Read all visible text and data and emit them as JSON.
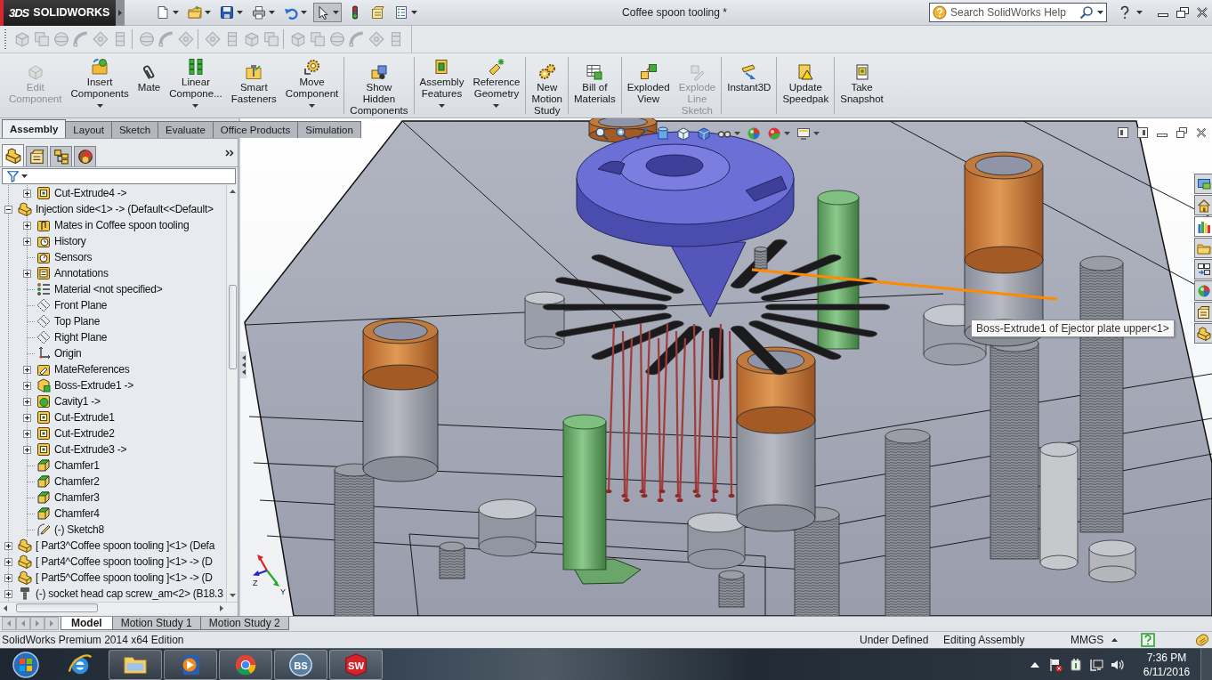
{
  "title_bar": {
    "logo_mark": "3DS",
    "logo_text": "SOLIDWORKS",
    "document_title": "Coffee spoon tooling *",
    "search": {
      "placeholder": "Search SolidWorks Help"
    }
  },
  "quick_access": [
    {
      "kind": "new-document",
      "dropdown": true,
      "selected": false
    },
    {
      "kind": "open",
      "dropdown": true,
      "selected": false
    },
    {
      "kind": "save",
      "dropdown": true,
      "selected": false
    },
    {
      "kind": "print",
      "dropdown": true,
      "selected": false
    },
    {
      "kind": "undo",
      "dropdown": true,
      "selected": false
    },
    {
      "kind": "select",
      "dropdown": true,
      "selected": true
    },
    {
      "kind": "rebuild",
      "dropdown": false,
      "selected": false
    },
    {
      "kind": "options",
      "dropdown": false,
      "selected": false
    },
    {
      "kind": "file-properties",
      "dropdown": true,
      "selected": false
    }
  ],
  "secondary_toolbar": {
    "disabled": true
  },
  "command_groups": [
    {
      "buttons": [
        {
          "kind": "edit-component",
          "label": "Edit\nComponent",
          "disabled": true,
          "dropdown": false
        },
        {
          "kind": "insert-components",
          "label": "Insert\nComponents",
          "disabled": false,
          "dropdown": true
        },
        {
          "kind": "mate",
          "label": "Mate",
          "disabled": false,
          "dropdown": false
        },
        {
          "kind": "linear-pattern",
          "label": "Linear\nCompone...",
          "disabled": false,
          "dropdown": true
        },
        {
          "kind": "smart-fasteners",
          "label": "Smart\nFasteners",
          "disabled": false,
          "dropdown": false
        },
        {
          "kind": "move-component",
          "label": "Move\nComponent",
          "disabled": false,
          "dropdown": true
        }
      ]
    },
    {
      "buttons": [
        {
          "kind": "show-hidden",
          "label": "Show\nHidden\nComponents",
          "disabled": false,
          "dropdown": false
        }
      ]
    },
    {
      "buttons": [
        {
          "kind": "assembly-features",
          "label": "Assembly\nFeatures",
          "disabled": false,
          "dropdown": true
        },
        {
          "kind": "reference-geometry",
          "label": "Reference\nGeometry",
          "disabled": false,
          "dropdown": true
        }
      ]
    },
    {
      "buttons": [
        {
          "kind": "motion-study",
          "label": "New\nMotion\nStudy",
          "disabled": false,
          "dropdown": false
        }
      ]
    },
    {
      "buttons": [
        {
          "kind": "bill-of-materials",
          "label": "Bill of\nMaterials",
          "disabled": false,
          "dropdown": false
        }
      ]
    },
    {
      "buttons": [
        {
          "kind": "exploded-view",
          "label": "Exploded\nView",
          "disabled": false,
          "dropdown": false
        },
        {
          "kind": "explode-line-sketch",
          "label": "Explode\nLine\nSketch",
          "disabled": true,
          "dropdown": false
        }
      ]
    },
    {
      "buttons": [
        {
          "kind": "instant3d",
          "label": "Instant3D",
          "disabled": false,
          "dropdown": false
        }
      ]
    },
    {
      "buttons": [
        {
          "kind": "update-speedpak",
          "label": "Update\nSpeedpak",
          "disabled": false,
          "dropdown": false
        }
      ]
    },
    {
      "buttons": [
        {
          "kind": "take-snapshot",
          "label": "Take\nSnapshot",
          "disabled": false,
          "dropdown": false
        }
      ]
    }
  ],
  "tabs": [
    {
      "label": "Assembly",
      "selected": true
    },
    {
      "label": "Layout",
      "selected": false
    },
    {
      "label": "Sketch",
      "selected": false
    },
    {
      "label": "Evaluate",
      "selected": false
    },
    {
      "label": "Office Products",
      "selected": false
    },
    {
      "label": "Simulation",
      "selected": false
    }
  ],
  "manager_tabs": [
    {
      "kind": "feature-manager",
      "selected": true
    },
    {
      "kind": "property-manager",
      "selected": false
    },
    {
      "kind": "configuration-manager",
      "selected": false
    },
    {
      "kind": "display-manager",
      "selected": false
    }
  ],
  "feature_tree": [
    {
      "children": [
        {
          "label": "Cut-Extrude4 ->",
          "kind": "cut-extrude",
          "expandable": true,
          "expanded": false
        }
      ]
    },
    {
      "label": "Injection side<1> -> (Default<<Default>",
      "kind": "part",
      "expandable": true,
      "expanded": true,
      "children": [
        {
          "label": "Mates in Coffee spoon tooling",
          "kind": "mates",
          "expandable": true,
          "expanded": false
        },
        {
          "label": "History",
          "kind": "history",
          "expandable": true,
          "expanded": false
        },
        {
          "label": "Sensors",
          "kind": "sensors",
          "expandable": false
        },
        {
          "label": "Annotations",
          "kind": "annotations",
          "expandable": true,
          "expanded": false
        },
        {
          "label": "Material <not specified>",
          "kind": "material",
          "expandable": false
        },
        {
          "label": "Front Plane",
          "kind": "plane",
          "expandable": false
        },
        {
          "label": "Top Plane",
          "kind": "plane",
          "expandable": false
        },
        {
          "label": "Right Plane",
          "kind": "plane",
          "expandable": false
        },
        {
          "label": "Origin",
          "kind": "origin",
          "expandable": false
        },
        {
          "label": "MateReferences",
          "kind": "mate-references",
          "expandable": true,
          "expanded": false
        },
        {
          "label": "Boss-Extrude1 ->",
          "kind": "boss-extrude",
          "expandable": true,
          "expanded": false
        },
        {
          "label": "Cavity1 ->",
          "kind": "cavity",
          "expandable": true,
          "expanded": false
        },
        {
          "label": "Cut-Extrude1",
          "kind": "cut-extrude",
          "expandable": true,
          "expanded": false
        },
        {
          "label": "Cut-Extrude2",
          "kind": "cut-extrude",
          "expandable": true,
          "expanded": false
        },
        {
          "label": "Cut-Extrude3 ->",
          "kind": "cut-extrude",
          "expandable": true,
          "expanded": false
        },
        {
          "label": "Chamfer1",
          "kind": "chamfer",
          "expandable": false
        },
        {
          "label": "Chamfer2",
          "kind": "chamfer",
          "expandable": false
        },
        {
          "label": "Chamfer3",
          "kind": "chamfer",
          "expandable": false
        },
        {
          "label": "Chamfer4",
          "kind": "chamfer",
          "expandable": false
        },
        {
          "label": "(-) Sketch8",
          "kind": "sketch",
          "expandable": false
        }
      ]
    },
    {
      "label": "[ Part3^Coffee spoon tooling ]<1> (Defa",
      "kind": "part",
      "expandable": true,
      "expanded": false
    },
    {
      "label": "[ Part4^Coffee spoon tooling ]<1> -> (D",
      "kind": "part",
      "expandable": true,
      "expanded": false
    },
    {
      "label": "[ Part5^Coffee spoon tooling ]<1> -> (D",
      "kind": "part",
      "expandable": true,
      "expanded": false
    },
    {
      "label": "(-) socket head cap screw_am<2> (B18.3",
      "kind": "screw",
      "expandable": true,
      "expanded": false
    }
  ],
  "viewport": {
    "tooltip": "Boss-Extrude1 of Ejector plate upper<1>",
    "triad_labels": [
      "Z",
      "Y"
    ]
  },
  "task_pane": [
    {
      "kind": "resources",
      "selected": false
    },
    {
      "kind": "home",
      "selected": false
    },
    {
      "kind": "library",
      "selected": true
    },
    {
      "kind": "file-explorer",
      "selected": false
    },
    {
      "kind": "view-palette",
      "selected": false
    },
    {
      "kind": "appearances",
      "selected": false
    },
    {
      "kind": "custom-properties",
      "selected": false
    },
    {
      "kind": "toolbox",
      "selected": false
    }
  ],
  "bottom_tabs": [
    {
      "label": "Model",
      "selected": true
    },
    {
      "label": "Motion Study 1",
      "selected": false
    },
    {
      "label": "Motion Study 2",
      "selected": false
    }
  ],
  "status_bar": {
    "edition": "SolidWorks Premium 2014 x64 Edition",
    "state": "Under Defined",
    "mode": "Editing Assembly",
    "units": "MMGS"
  },
  "taskbar": {
    "apps": [
      {
        "kind": "internet-explorer",
        "running": false
      },
      {
        "kind": "file-explorer",
        "running": true
      },
      {
        "kind": "media-player",
        "running": true
      },
      {
        "kind": "chrome",
        "running": true
      },
      {
        "kind": "bs-player",
        "running": true,
        "logo_text": "BS"
      },
      {
        "kind": "solidworks",
        "running": true,
        "logo_text": "SW"
      }
    ],
    "clock": {
      "time": "7:36 PM",
      "date": "6/11/2016"
    }
  }
}
